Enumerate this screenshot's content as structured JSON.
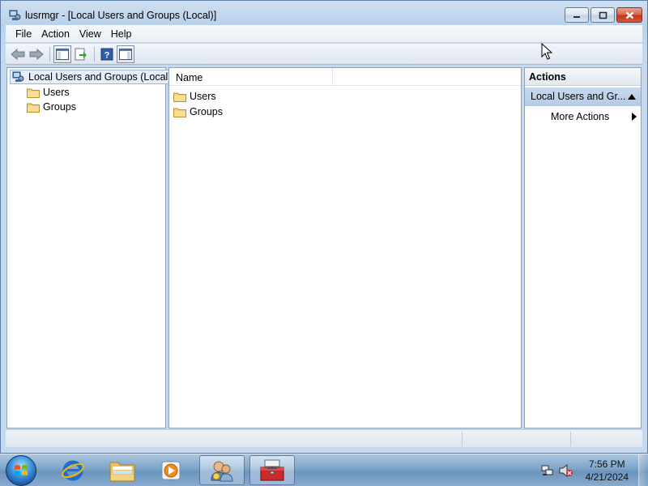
{
  "window": {
    "title": "lusrmgr - [Local Users and Groups (Local)]"
  },
  "menu": [
    "File",
    "Action",
    "View",
    "Help"
  ],
  "tree": {
    "root": "Local Users and Groups (Local)",
    "children": [
      "Users",
      "Groups"
    ]
  },
  "list": {
    "column_name": "Name",
    "items": [
      "Users",
      "Groups"
    ]
  },
  "actions": {
    "title": "Actions",
    "section": "Local Users and Gr...",
    "more": "More Actions"
  },
  "taskbar": {
    "time": "7:56 PM",
    "date": "4/21/2024",
    "icons": [
      "start-orb",
      "internet-explorer-icon",
      "file-explorer-icon",
      "media-player-icon",
      "users-management-icon",
      "toolbox-icon"
    ]
  },
  "colors": {
    "title_gradient": "#b9d1ea",
    "selection": "#e5eef9",
    "actions_section": "#b4cbe6",
    "close_button": "#c3381f",
    "folder": "#f3d27a"
  }
}
